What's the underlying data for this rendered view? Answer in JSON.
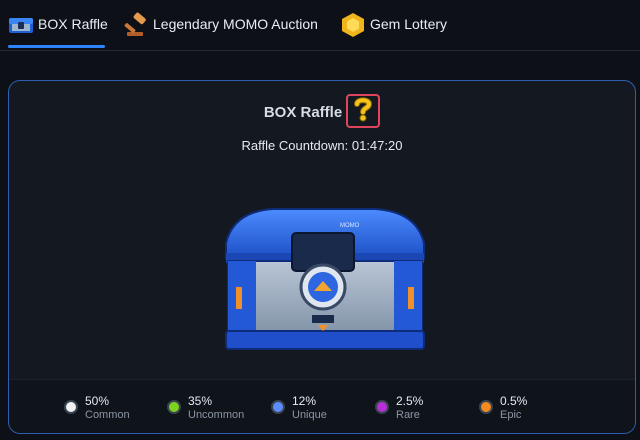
{
  "tabs": [
    {
      "label": "BOX Raffle",
      "icon": "chest-icon",
      "active": true
    },
    {
      "label": "Legendary MOMO Auction",
      "icon": "gavel-icon",
      "active": false
    },
    {
      "label": "Gem Lottery",
      "icon": "gem-icon",
      "active": false
    }
  ],
  "raffle": {
    "title": "BOX Raffle",
    "countdown": "Raffle Countdown: 01:47:20",
    "help_icon": "question-mark-icon"
  },
  "rates": [
    {
      "percent": "50%",
      "name": "Common",
      "color": "#f2f2f2"
    },
    {
      "percent": "35%",
      "name": "Uncommon",
      "color": "#7ed321"
    },
    {
      "percent": "12%",
      "name": "Unique",
      "color": "#5b8dff"
    },
    {
      "percent": "2.5%",
      "name": "Rare",
      "color": "#b72fd8"
    },
    {
      "percent": "0.5%",
      "name": "Epic",
      "color": "#f58a1f"
    }
  ],
  "colors": {
    "accent": "#2e83ff",
    "highlight_border": "#e0455e"
  }
}
